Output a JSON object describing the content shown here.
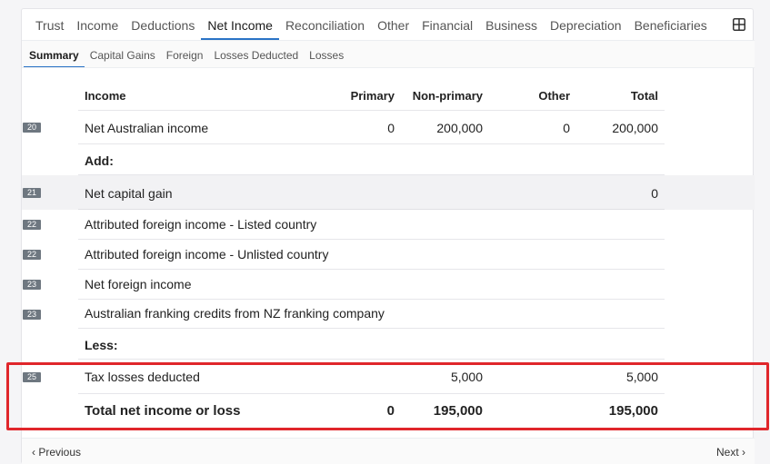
{
  "tabs": [
    "Trust",
    "Income",
    "Deductions",
    "Net Income",
    "Reconciliation",
    "Other",
    "Financial",
    "Business",
    "Depreciation",
    "Beneficiaries"
  ],
  "active_tab": "Net Income",
  "subtabs": [
    "Summary",
    "Capital Gains",
    "Foreign",
    "Losses Deducted",
    "Losses"
  ],
  "active_subtab": "Summary",
  "table": {
    "headers": {
      "label": "Income",
      "primary": "Primary",
      "nonprimary": "Non-primary",
      "other": "Other",
      "total": "Total"
    },
    "rows": [
      {
        "badge": "20",
        "label": "Net Australian income",
        "primary": "0",
        "nonprimary": "200,000",
        "other": "0",
        "total": "200,000"
      },
      {
        "badge": "",
        "label": "Add:",
        "primary": "",
        "nonprimary": "",
        "other": "",
        "total": ""
      },
      {
        "badge": "21",
        "label": "Net capital gain",
        "primary": "",
        "nonprimary": "",
        "other": "",
        "total": "0"
      },
      {
        "badge": "22",
        "label": "Attributed foreign income - Listed country",
        "primary": "",
        "nonprimary": "",
        "other": "",
        "total": ""
      },
      {
        "badge": "22",
        "label": "Attributed foreign income - Unlisted country",
        "primary": "",
        "nonprimary": "",
        "other": "",
        "total": ""
      },
      {
        "badge": "23",
        "label": "Net foreign income",
        "primary": "",
        "nonprimary": "",
        "other": "",
        "total": ""
      },
      {
        "badge": "23",
        "label": "Australian franking credits from NZ franking company",
        "primary": "",
        "nonprimary": "",
        "other": "",
        "total": ""
      },
      {
        "badge": "",
        "label": "Less:",
        "primary": "",
        "nonprimary": "",
        "other": "",
        "total": ""
      },
      {
        "badge": "25",
        "label": "Tax losses deducted",
        "primary": "",
        "nonprimary": "5,000",
        "other": "",
        "total": "5,000"
      },
      {
        "badge": "",
        "label": "Total net income or loss",
        "primary": "0",
        "nonprimary": "195,000",
        "other": "",
        "total": "195,000"
      }
    ]
  },
  "pager": {
    "previous": "‹ Previous",
    "next": "Next ›"
  },
  "colors": {
    "accent": "#2a73c6",
    "highlight": "#e0262b",
    "badge": "#6e7780"
  }
}
